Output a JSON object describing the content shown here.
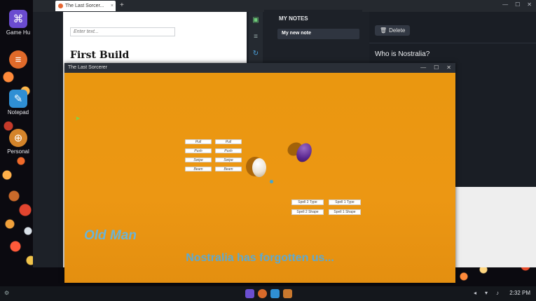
{
  "desktop": {
    "icons": [
      {
        "label": "Game Hu",
        "icon": "gamepad-icon"
      },
      {
        "label": "",
        "icon": "document-circle-icon"
      },
      {
        "label": "Notepad",
        "icon": "notepad-icon"
      },
      {
        "label": "Personal",
        "icon": "globe-icon"
      }
    ]
  },
  "notes_app": {
    "tab_title": "The Last Sorcer...",
    "editor": {
      "input_placeholder": "Enter text...",
      "heading": "First Build"
    },
    "sidebar_title": "MY NOTES",
    "notes": [
      {
        "title": "My new note"
      }
    ],
    "delete_label": "Delete",
    "note_title": "Who is Nostralia?"
  },
  "game_window": {
    "title": "The Last Sorcerer",
    "cursor_glyph": "➤",
    "spell_buttons": [
      [
        "Pull",
        "Pull"
      ],
      [
        "Push",
        "Push"
      ],
      [
        "Swipe",
        "Swipe"
      ],
      [
        "Beam",
        "Beam"
      ]
    ],
    "combo_buttons": [
      "Spell 2 Type",
      "Spell 1 Type",
      "Spell 2 Shape",
      "Spell 1 Shape"
    ],
    "character_name": "Old Man",
    "dialogue": "Nostralia has forgotten us..."
  },
  "taskbar": {
    "clock": "2:32 PM"
  },
  "colors": {
    "game_bg": "#e89612",
    "dialogue_text": "#5ea9cf",
    "notes_bg": "#1d2128"
  }
}
